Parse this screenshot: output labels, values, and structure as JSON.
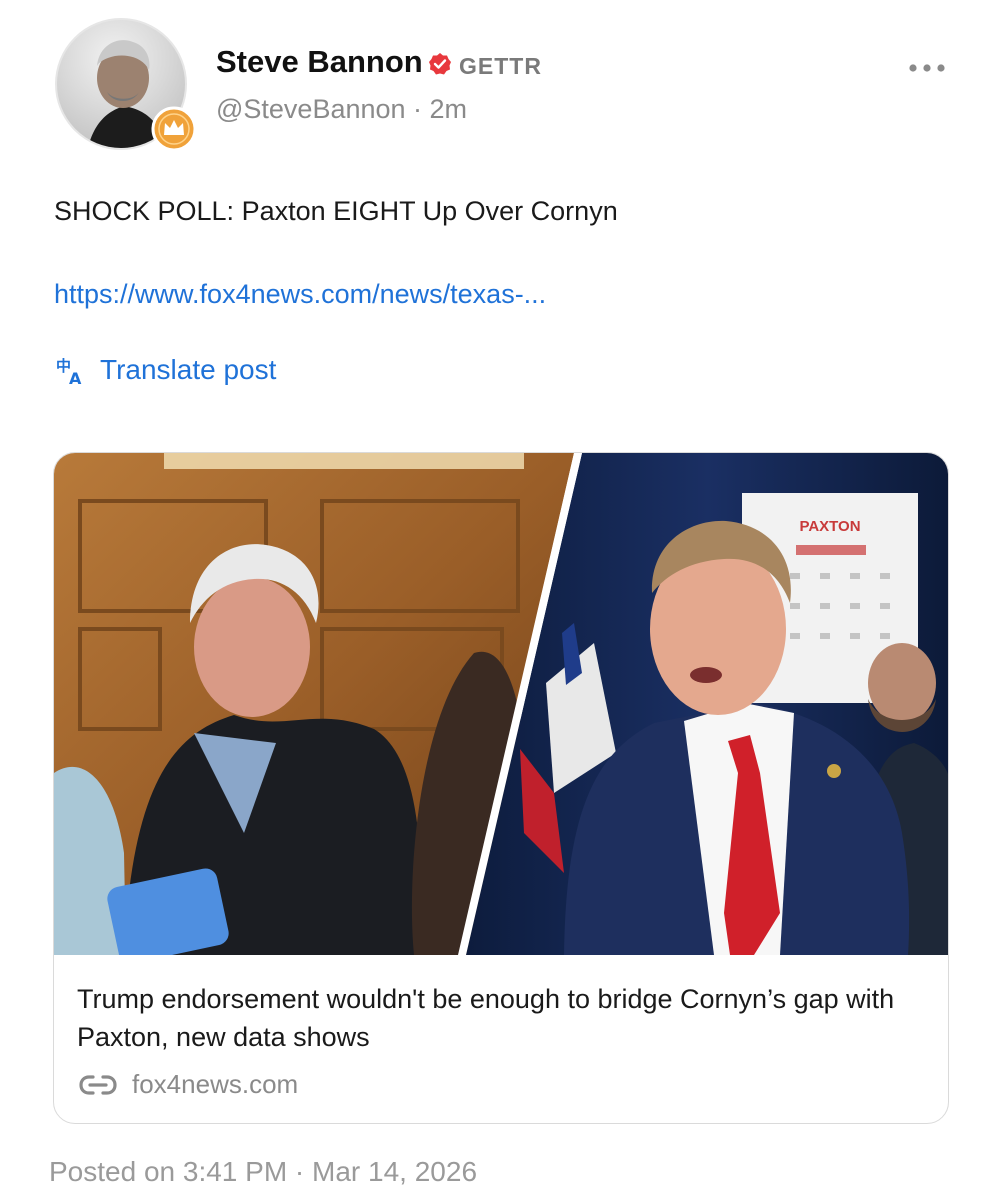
{
  "post": {
    "author_name": "Steve Bannon",
    "platform_badge": "GETTR",
    "handle_line": "@SteveBannon · 2m",
    "text": "SHOCK POLL: Paxton EIGHT Up Over Cornyn",
    "link": "https://www.fox4news.com/news/texas-...",
    "translate_label": "Translate post",
    "posted_on": "Posted on 3:41 PM · Mar 14, 2026"
  },
  "card": {
    "title": "Trump endorsement wouldn't be enough to bridge Cornyn’s gap with Paxton, new data shows",
    "domain": "fox4news.com",
    "image_sign_text": "PAXTON"
  },
  "icons": {
    "verified": "verified-badge-icon",
    "avatar_badge": "crown-badge-icon",
    "more": "more-options-icon",
    "translate": "translate-icon",
    "link": "link-icon"
  },
  "colors": {
    "link_blue": "#1f72d8",
    "verified_red": "#e8383d",
    "badge_orange": "#f0a23a",
    "muted_gray": "#8a8a8a"
  }
}
